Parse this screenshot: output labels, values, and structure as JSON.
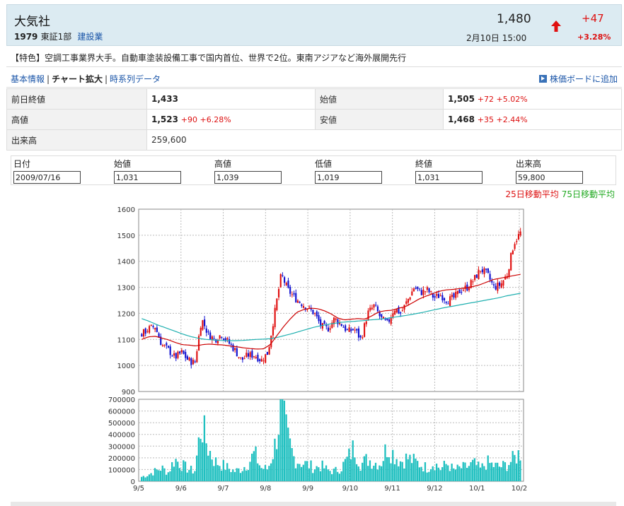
{
  "header": {
    "company": "大気社",
    "code": "1979",
    "market": "東証1部",
    "sector": "建設業",
    "price": "1,480",
    "change": "+47",
    "change_pct": "+3.28%",
    "date": "2月10日 15:00"
  },
  "feature": "【特色】空調工事業界大手。自動車塗装設備工事で国内首位、世界で2位。東南アジアなど海外展開先行",
  "tabs": {
    "basic": "基本情報",
    "chart": "チャート拡大",
    "timeseries": "時系列データ",
    "sep": "|",
    "add_board": "株価ボードに追加"
  },
  "quote": {
    "prev_close_label": "前日終値",
    "prev_close": "1,433",
    "open_label": "始値",
    "open": "1,505",
    "open_diff": "+72 +5.02%",
    "high_label": "高値",
    "high": "1,523",
    "high_diff": "+90 +6.28%",
    "low_label": "安値",
    "low": "1,468",
    "low_diff": "+35 +2.44%",
    "volume_label": "出来高",
    "volume": "259,600"
  },
  "detail": {
    "date_label": "日付",
    "date": "2009/07/16",
    "open_label": "始値",
    "open": "1,031",
    "high_label": "高値",
    "high": "1,039",
    "low_label": "低値",
    "low": "1,019",
    "close_label": "終値",
    "close": "1,031",
    "volume_label": "出来高",
    "volume": "59,800"
  },
  "legend": {
    "ma25": "25日移動平均",
    "ma75": "75日移動平均"
  },
  "colors": {
    "up": "#e01010",
    "down": "#1010d0",
    "ma25": "#cc0000",
    "ma75": "#20b0b0",
    "volume": "#20c0c0"
  },
  "chart_data": {
    "type": "candlestick",
    "price_axis": {
      "ylim": [
        900,
        1600
      ],
      "ticks": [
        "900",
        "1000",
        "1100",
        "1200",
        "1300",
        "1400",
        "1500",
        "1600"
      ]
    },
    "volume_axis": {
      "ylim": [
        0,
        700000
      ],
      "ticks": [
        "0",
        "100000",
        "200000",
        "300000",
        "400000",
        "500000",
        "600000",
        "700000"
      ]
    },
    "x_tick_labels": [
      "9/5",
      "9/6",
      "9/7",
      "9/8",
      "9/9",
      "9/10",
      "9/11",
      "9/12",
      "10/1",
      "10/2"
    ],
    "close_path": [
      1120,
      1140,
      1150,
      1080,
      1060,
      1030,
      1050,
      1020,
      1010,
      1180,
      1120,
      1100,
      1120,
      1090,
      1060,
      1020,
      1040,
      1040,
      1020,
      1050,
      1200,
      1350,
      1290,
      1260,
      1240,
      1220,
      1200,
      1150,
      1140,
      1180,
      1160,
      1130,
      1140,
      1100,
      1200,
      1230,
      1180,
      1160,
      1220,
      1200,
      1250,
      1300,
      1280,
      1290,
      1260,
      1270,
      1250,
      1260,
      1290,
      1300,
      1330,
      1370,
      1350,
      1300,
      1310,
      1350,
      1470,
      1510
    ],
    "ma25_path": [
      1100,
      1110,
      1112,
      1105,
      1098,
      1088,
      1080,
      1078,
      1075,
      1080,
      1082,
      1080,
      1079,
      1075,
      1072,
      1068,
      1065,
      1063,
      1064,
      1080,
      1115,
      1150,
      1180,
      1205,
      1215,
      1220,
      1218,
      1210,
      1198,
      1182,
      1175,
      1178,
      1180,
      1178,
      1190,
      1205,
      1210,
      1212,
      1220,
      1226,
      1240,
      1255,
      1266,
      1275,
      1285,
      1290,
      1292,
      1295,
      1298,
      1303,
      1310,
      1320,
      1330,
      1335,
      1340,
      1345,
      1350
    ],
    "ma75_path": [
      1180,
      1170,
      1158,
      1148,
      1138,
      1128,
      1118,
      1110,
      1104,
      1100,
      1098,
      1096,
      1095,
      1095,
      1096,
      1098,
      1100,
      1101,
      1103,
      1108,
      1115,
      1122,
      1130,
      1138,
      1146,
      1152,
      1158,
      1162,
      1166,
      1168,
      1170,
      1172,
      1175,
      1177,
      1180,
      1184,
      1188,
      1192,
      1197,
      1202,
      1208,
      1214,
      1220,
      1225,
      1230,
      1235,
      1240,
      1245,
      1250,
      1255,
      1260,
      1267,
      1272,
      1277
    ],
    "volume_path": [
      40000,
      60000,
      90000,
      120000,
      80000,
      200000,
      150000,
      110000,
      90000,
      520000,
      300000,
      180000,
      150000,
      120000,
      90000,
      110000,
      160000,
      250000,
      120000,
      110000,
      300000,
      650000,
      380000,
      200000,
      170000,
      150000,
      120000,
      140000,
      100000,
      90000,
      120000,
      200000,
      310000,
      150000,
      200000,
      170000,
      160000,
      320000,
      240000,
      180000,
      210000,
      180000,
      150000,
      120000,
      170000,
      110000,
      160000,
      100000,
      120000,
      130000,
      160000,
      110000,
      170000,
      140000,
      130000,
      150000,
      200000,
      260000
    ]
  }
}
